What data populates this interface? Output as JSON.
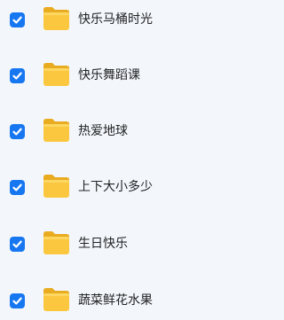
{
  "accent_color": "#1677f0",
  "folder_color": "#fbc73f",
  "items": [
    {
      "label": "快乐马桶时光",
      "checked": true,
      "icon": "folder-icon"
    },
    {
      "label": "快乐舞蹈课",
      "checked": true,
      "icon": "folder-icon"
    },
    {
      "label": "热爱地球",
      "checked": true,
      "icon": "folder-icon"
    },
    {
      "label": "上下大小多少",
      "checked": true,
      "icon": "folder-icon"
    },
    {
      "label": "生日快乐",
      "checked": true,
      "icon": "folder-icon"
    },
    {
      "label": "蔬菜鲜花水果",
      "checked": true,
      "icon": "folder-icon"
    }
  ]
}
